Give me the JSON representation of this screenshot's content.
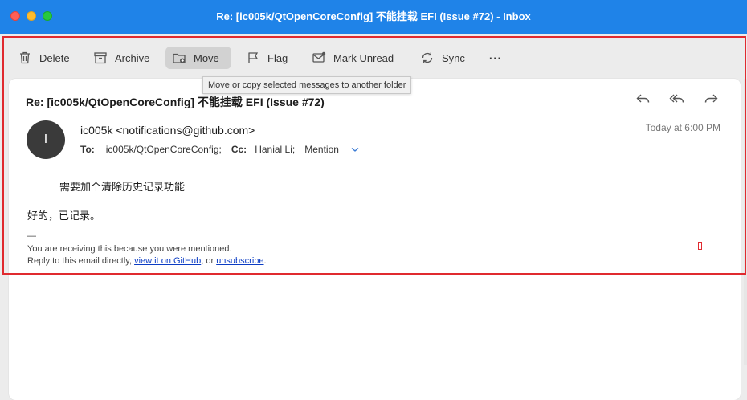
{
  "window": {
    "title": "Re: [ic005k/QtOpenCoreConfig] 不能挂载 EFI (Issue #72) - Inbox"
  },
  "toolbar": {
    "delete": "Delete",
    "archive": "Archive",
    "move": "Move",
    "flag": "Flag",
    "mark_unread": "Mark Unread",
    "sync": "Sync",
    "more": "···"
  },
  "tooltip": "Move or copy selected messages to another folder",
  "message": {
    "subject": "Re: [ic005k/QtOpenCoreConfig] 不能挂载 EFI (Issue #72)",
    "avatar_initial": "I",
    "sender": "ic005k <notifications@github.com>",
    "date": "Today at 6:00 PM",
    "to_label": "To:",
    "to_value": "ic005k/QtOpenCoreConfig;",
    "cc_label": "Cc:",
    "cc_1": "Hanial Li;",
    "cc_2": "Mention",
    "quote": "需要加个清除历史记录功能",
    "reply": "好的，已记录。",
    "separator": "—",
    "footer_1": "You are receiving this because you were mentioned.",
    "footer_2_prefix": "Reply to this email directly, ",
    "footer_link_1": "view it on GitHub",
    "footer_2_mid": ", or ",
    "footer_link_2": "unsubscribe",
    "footer_2_suffix": "."
  }
}
